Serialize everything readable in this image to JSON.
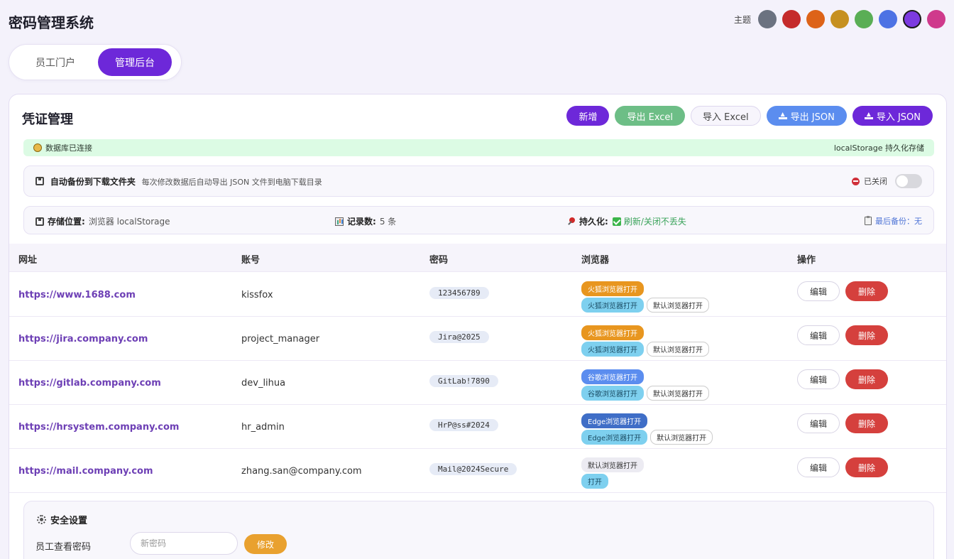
{
  "app": {
    "title": "密码管理系统"
  },
  "theme": {
    "label": "主题",
    "swatches": [
      "#6b7280",
      "#c52b2b",
      "#dd6318",
      "#c69020",
      "#5aae55",
      "#4d72e4",
      "#7c3ae0",
      "#cf3a8c"
    ],
    "active_index": 6
  },
  "mode": {
    "tabs": [
      "员工门户",
      "管理后台"
    ],
    "active": 1
  },
  "card": {
    "title": "凭证管理"
  },
  "toolbar": {
    "add": "新增",
    "export_excel": "导出 Excel",
    "import_excel": "导入 Excel",
    "export_json": "导出 JSON",
    "import_json": "导入 JSON"
  },
  "db_status": {
    "left": "数据库已连接",
    "right": "localStorage 持久化存储"
  },
  "auto_backup": {
    "title": "自动备份到下载文件夹",
    "desc": "每次修改数据后自动导出 JSON 文件到电脑下载目录",
    "state": "已关闭",
    "enabled": false
  },
  "storage": {
    "location_label": "存储位置:",
    "location_value": "浏览器 localStorage",
    "count_label": "记录数:",
    "count_value": "5 条",
    "persist_label": "持久化:",
    "persist_value": "刷新/关闭不丢失",
    "last_backup": "最后备份：无"
  },
  "table": {
    "headers": [
      "网址",
      "账号",
      "密码",
      "浏览器",
      "操作"
    ],
    "edit_label": "编辑",
    "delete_label": "删除",
    "rows": [
      {
        "url": "https://www.1688.com",
        "account": "kissfox",
        "password": "123456789",
        "badge_main": "火狐浏览器打开",
        "badge_sub": "火狐浏览器打开",
        "badge_default": "默认浏览器打开"
      },
      {
        "url": "https://jira.company.com",
        "account": "project_manager",
        "password": "Jira@2025",
        "badge_main": "火狐浏览器打开",
        "badge_sub": "火狐浏览器打开",
        "badge_default": "默认浏览器打开"
      },
      {
        "url": "https://gitlab.company.com",
        "account": "dev_lihua",
        "password": "GitLab!7890",
        "badge_main": "谷歌浏览器打开",
        "badge_sub": "谷歌浏览器打开",
        "badge_default": "默认浏览器打开"
      },
      {
        "url": "https://hrsystem.company.com",
        "account": "hr_admin",
        "password": "HrP@ss#2024",
        "badge_main": "Edge浏览器打开",
        "badge_sub": "Edge浏览器打开",
        "badge_default": "默认浏览器打开"
      },
      {
        "url": "https://mail.company.com",
        "account": "zhang.san@company.com",
        "password": "Mail@2024Secure",
        "badge_main": "默认浏览器打开",
        "badge_sub": "打开"
      }
    ]
  },
  "security": {
    "title": "安全设置",
    "label": "员工查看密码",
    "placeholder": "新密码",
    "button": "修改"
  }
}
